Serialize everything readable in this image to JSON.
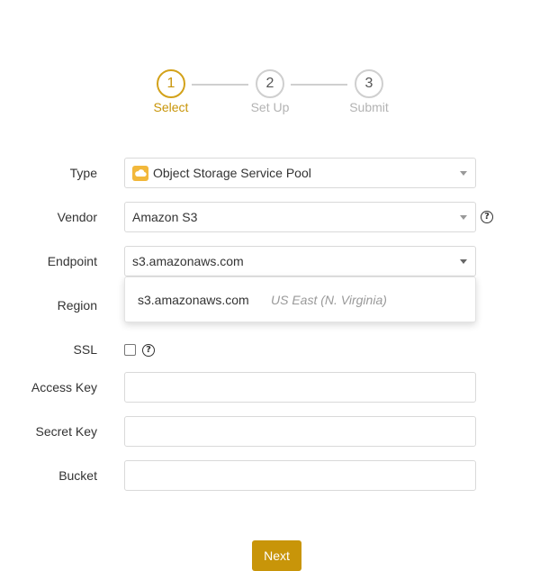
{
  "stepper": {
    "steps": [
      {
        "number": "1",
        "label": "Select",
        "state": "active"
      },
      {
        "number": "2",
        "label": "Set Up",
        "state": "inactive"
      },
      {
        "number": "3",
        "label": "Submit",
        "state": "inactive"
      }
    ]
  },
  "form": {
    "type": {
      "label": "Type",
      "value": "Object Storage Service Pool",
      "icon": "cloud-icon"
    },
    "vendor": {
      "label": "Vendor",
      "value": "Amazon S3"
    },
    "endpoint": {
      "label": "Endpoint",
      "value": "s3.amazonaws.com"
    },
    "region": {
      "label": "Region"
    },
    "ssl": {
      "label": "SSL",
      "checked": false
    },
    "access_key": {
      "label": "Access Key",
      "value": ""
    },
    "secret_key": {
      "label": "Secret Key",
      "value": ""
    },
    "bucket": {
      "label": "Bucket",
      "value": ""
    },
    "help_symbol": "?"
  },
  "endpoint_dropdown": {
    "options": [
      {
        "endpoint": "s3.amazonaws.com",
        "region": "US East (N. Virginia)"
      }
    ]
  },
  "actions": {
    "next_label": "Next"
  },
  "colors": {
    "accent": "#c89509",
    "inactive": "#cfcfcf",
    "muted_text": "#999999"
  }
}
